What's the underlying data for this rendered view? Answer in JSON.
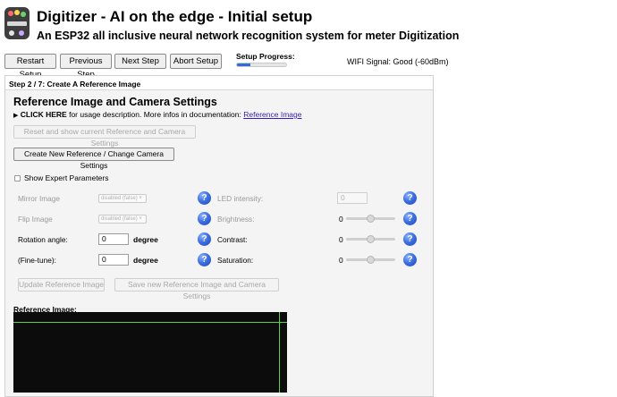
{
  "header": {
    "title": "Digitizer - AI on the edge - Initial setup",
    "subtitle": "An ESP32 all inclusive neural network recognition system for meter Digitization"
  },
  "toolbar": {
    "restart_label": "Restart Setup",
    "previous_label": "Previous Step",
    "next_label": "Next Step",
    "abort_label": "Abort Setup",
    "progress_label": "Setup Progress:",
    "progress_value": 0.28,
    "wifi_text": "WIFI Signal: Good (-60dBm)"
  },
  "step": {
    "header": "Step 2 / 7: Create A Reference Image",
    "section_title": "Reference Image and Camera Settings",
    "click_here": "CLICK HERE",
    "usage_text": "for usage description. More infos in documentation:",
    "doc_link": "Reference Image",
    "reset_button": "Reset and show current Reference and Camera Settings",
    "create_button": "Create New Reference / Change Camera Settings",
    "expert_label": "Show Expert Parameters",
    "update_button": "Update Reference Image",
    "save_button": "Save new Reference Image and Camera Settings",
    "reference_label": "Reference Image:"
  },
  "params": {
    "mirror": {
      "label": "Mirror Image",
      "value": "disabled (false)"
    },
    "flip": {
      "label": "Flip Image",
      "value": "disabled (false)"
    },
    "rotation": {
      "label": "Rotation angle:",
      "value": "0",
      "unit": "degree"
    },
    "finetune": {
      "label": "(Fine-tune):",
      "value": "0",
      "unit": "degree"
    },
    "led": {
      "label": "LED intensity:",
      "value": "0"
    },
    "brightness": {
      "label": "Brightness:",
      "value": "0"
    },
    "contrast": {
      "label": "Contrast:",
      "value": "0"
    },
    "saturation": {
      "label": "Saturation:",
      "value": "0"
    },
    "help_glyph": "?"
  },
  "colors": {
    "accent": "#2f6cd6",
    "help_icon": "#3d70e2",
    "guide_line": "#5ed049",
    "link": "#3a1fb0"
  }
}
